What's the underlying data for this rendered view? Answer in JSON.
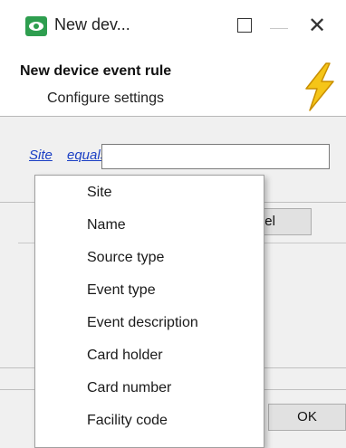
{
  "window": {
    "title": "New dev...",
    "icon": "eye-app-icon",
    "controls": {
      "minimize": "minimize-icon",
      "maximize": "maximize-icon",
      "close_glyph": "✕"
    }
  },
  "header": {
    "title": "New device event rule",
    "subtitle": "Configure settings",
    "icon": "lightning-bolt-icon",
    "icon_color": "#f5c518"
  },
  "filter": {
    "field_link": "Site",
    "operator_link": "equals",
    "value": "",
    "link_color": "#1a3fc4"
  },
  "buttons": {
    "cancel_label": "ancel",
    "ok_label": "OK"
  },
  "dropdown": {
    "items": [
      "Site",
      "Name",
      "Source type",
      "Event type",
      "Event description",
      "Card holder",
      "Card number",
      "Facility code"
    ]
  },
  "colors": {
    "app_icon": "#2e9e4f",
    "dialog_background": "#f0f0f0"
  }
}
